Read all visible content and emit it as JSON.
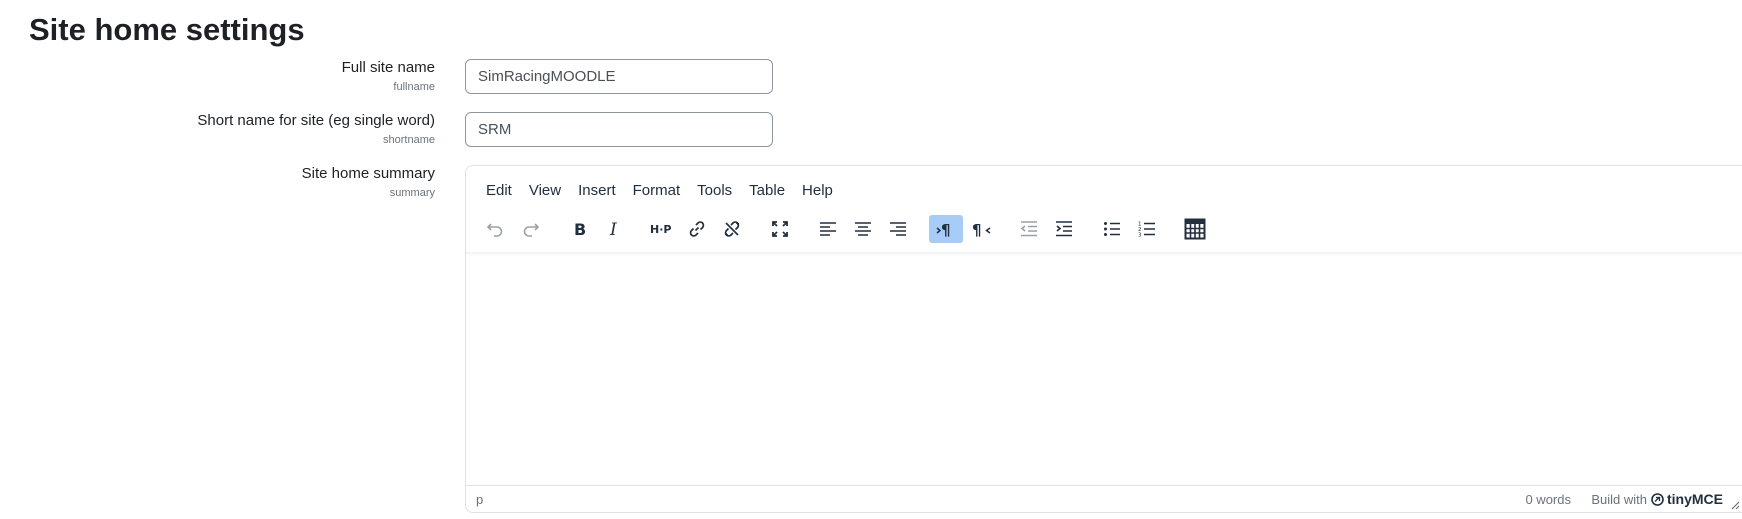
{
  "page": {
    "title": "Site home settings"
  },
  "fields": {
    "fullname": {
      "label": "Full site name",
      "key": "fullname",
      "value": "SimRacingMOODLE"
    },
    "shortname": {
      "label": "Short name for site (eg single word)",
      "key": "shortname",
      "value": "SRM"
    },
    "summary": {
      "label": "Site home summary",
      "key": "summary"
    }
  },
  "editor": {
    "menus": [
      "Edit",
      "View",
      "Insert",
      "Format",
      "Tools",
      "Table",
      "Help"
    ],
    "toolbar_icons": [
      "undo-icon",
      "redo-icon",
      "bold-icon",
      "italic-icon",
      "h5p-icon",
      "link-icon",
      "unlink-icon",
      "fullscreen-icon",
      "align-left-icon",
      "align-center-icon",
      "align-right-icon",
      "ltr-icon",
      "rtl-icon",
      "outdent-icon",
      "indent-icon",
      "bullet-list-icon",
      "numbered-list-icon",
      "table-icon"
    ],
    "active_icon": "ltr-icon",
    "status": {
      "path": "p",
      "word_count": "0 words",
      "build_with": "Build with",
      "brand": "tinyMCE"
    }
  }
}
